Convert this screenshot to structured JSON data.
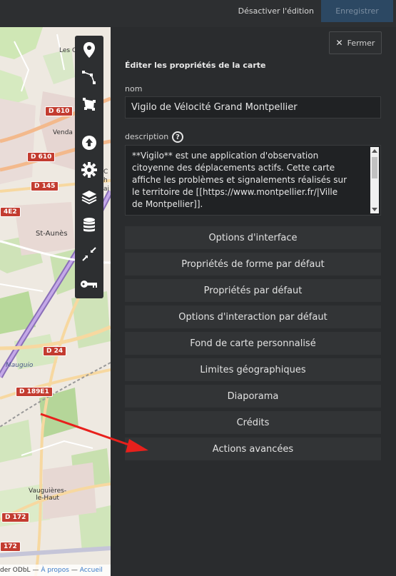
{
  "topbar": {
    "disable_edit_label": "Désactiver l'édition",
    "save_label": "Enregistrer"
  },
  "map": {
    "places": [
      "Les C",
      "Venda",
      "St-Aunès",
      "Mauguio",
      "Vauguières-\nle-Haut",
      "C",
      "h",
      "ai"
    ],
    "roads": [
      "D 610",
      "D 610",
      "D 145",
      "4E2",
      "D 24",
      "D 189E1",
      "D 172",
      "172"
    ],
    "attribution": {
      "prefix": "der ODbL",
      "about": "À propos",
      "home": "Accueil",
      "separator": "—"
    }
  },
  "toolbar": {
    "icons": [
      "marker-icon",
      "polyline-icon",
      "polygon-icon",
      "upload-icon",
      "gear-icon",
      "layers-icon",
      "database-icon",
      "collapse-icon",
      "key-icon"
    ]
  },
  "panel": {
    "close_label": "Fermer",
    "title": "Éditer les propriétés de la carte",
    "name_label": "nom",
    "name_value": "Vigilo de Vélocité Grand Montpellier",
    "description_label": "description",
    "help_glyph": "?",
    "description_value": "**Vigilo** est une application d'observation\ncitoyenne des déplacements actifs. Cette carte\naffiche les problèmes et signalements réalisés sur\nle territoire de [[https://www.montpellier.fr/|Ville\nde Montpellier]].",
    "sections": [
      "Options d'interface",
      "Propriétés de forme par défaut",
      "Propriétés par défaut",
      "Options d'interaction par défaut",
      "Fond de carte personnalisé",
      "Limites géographiques",
      "Diaporama",
      "Crédits",
      "Actions avancées"
    ]
  },
  "colors": {
    "accent_save": "#2c4863",
    "annotation_arrow": "#e8201c",
    "road_badge": "#c33c30"
  }
}
